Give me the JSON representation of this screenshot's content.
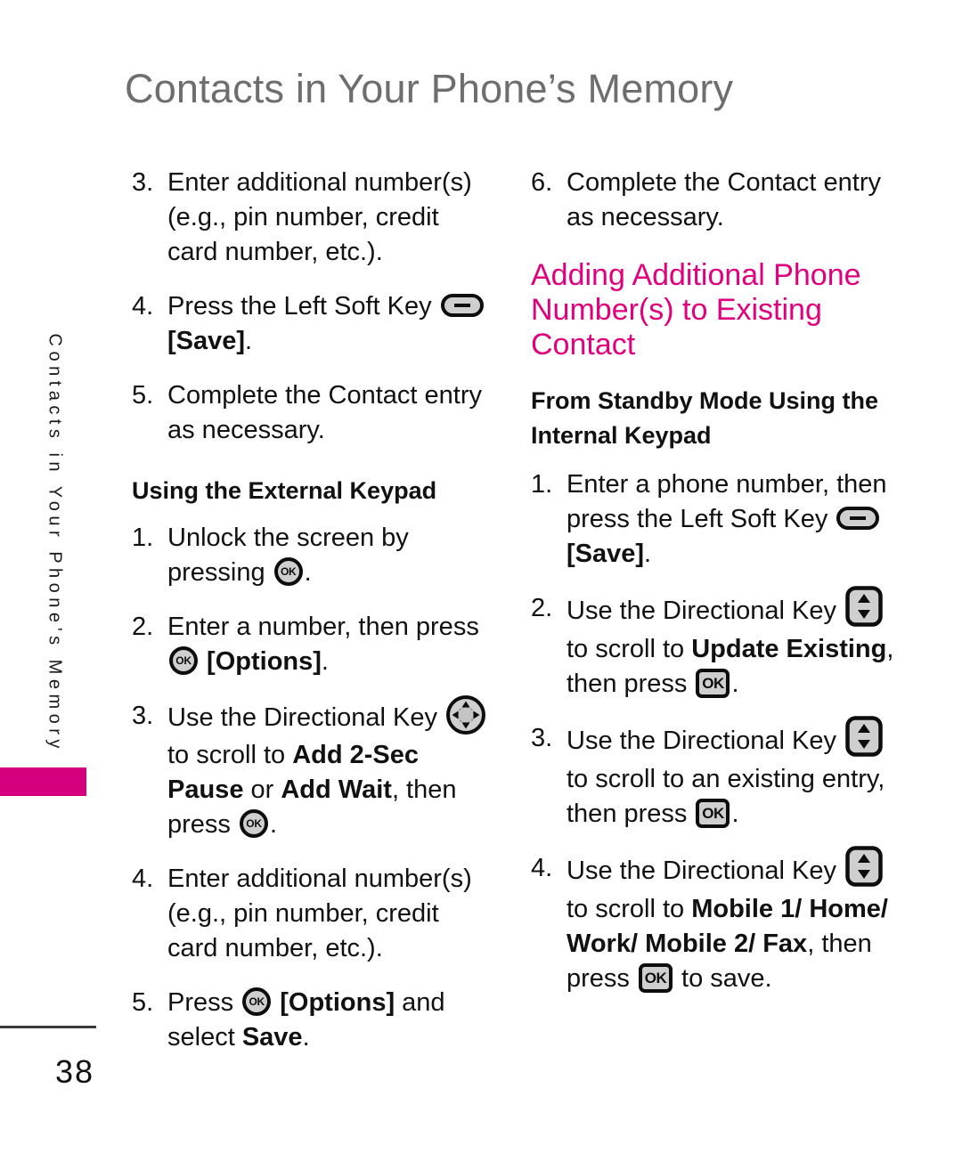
{
  "header": {
    "title": "Contacts in Your Phone’s Memory"
  },
  "side_tab": {
    "text": "Contacts in Your Phone’s Memory",
    "color": "#d6007f"
  },
  "colors": {
    "accent_pink": "#e0007d",
    "title_gray": "#6e6e6e",
    "body_black": "#111111",
    "icon_fill": "#cfcfcf",
    "icon_stroke": "#0d0d0d"
  },
  "left_column": {
    "steps_continued": [
      {
        "num": "3.",
        "parts": [
          {
            "type": "text",
            "value": "Enter additional number(s) (e.g., pin number, credit card number, etc.)."
          }
        ]
      },
      {
        "num": "4.",
        "parts": [
          {
            "type": "text",
            "value": "Press the Left Soft Key "
          },
          {
            "type": "icon",
            "icon": "left-soft-key"
          },
          {
            "type": "bold",
            "value": " [Save]"
          },
          {
            "type": "text",
            "value": "."
          }
        ]
      },
      {
        "num": "5.",
        "parts": [
          {
            "type": "text",
            "value": "Complete the Contact entry as necessary."
          }
        ]
      }
    ],
    "subheading": "Using the External Keypad",
    "steps": [
      {
        "num": "1.",
        "parts": [
          {
            "type": "text",
            "value": "Unlock the screen by pressing "
          },
          {
            "type": "icon",
            "icon": "ok-round-key"
          },
          {
            "type": "text",
            "value": "."
          }
        ]
      },
      {
        "num": "2.",
        "parts": [
          {
            "type": "text",
            "value": "Enter a number, then press "
          },
          {
            "type": "icon",
            "icon": "ok-round-key"
          },
          {
            "type": "bold",
            "value": " [Options]"
          },
          {
            "type": "text",
            "value": "."
          }
        ]
      },
      {
        "num": "3.",
        "parts": [
          {
            "type": "text",
            "value": "Use the Directional Key "
          },
          {
            "type": "icon",
            "icon": "directional-key-4way"
          },
          {
            "type": "text",
            "value": " to scroll to "
          },
          {
            "type": "bold",
            "value": "Add 2-Sec Pause"
          },
          {
            "type": "text",
            "value": " or "
          },
          {
            "type": "bold",
            "value": "Add Wait"
          },
          {
            "type": "text",
            "value": ", then press "
          },
          {
            "type": "icon",
            "icon": "ok-round-key"
          },
          {
            "type": "text",
            "value": "."
          }
        ]
      },
      {
        "num": "4.",
        "parts": [
          {
            "type": "text",
            "value": "Enter additional number(s) (e.g., pin number, credit card number, etc.)."
          }
        ]
      },
      {
        "num": "5.",
        "parts": [
          {
            "type": "text",
            "value": "Press "
          },
          {
            "type": "icon",
            "icon": "ok-round-key"
          },
          {
            "type": "bold",
            "value": " [Options]"
          },
          {
            "type": "text",
            "value": " and select "
          },
          {
            "type": "bold",
            "value": "Save"
          },
          {
            "type": "text",
            "value": "."
          }
        ]
      }
    ]
  },
  "right_column": {
    "steps_continued": [
      {
        "num": "6.",
        "parts": [
          {
            "type": "text",
            "value": "Complete the Contact entry as necessary."
          }
        ]
      }
    ],
    "section_heading": "Adding Additional Phone Number(s) to Existing Contact",
    "subheading": "From Standby Mode Using the Internal Keypad",
    "steps": [
      {
        "num": "1.",
        "parts": [
          {
            "type": "text",
            "value": "Enter a phone number, then press the Left Soft Key "
          },
          {
            "type": "icon",
            "icon": "left-soft-key"
          },
          {
            "type": "bold",
            "value": " [Save]"
          },
          {
            "type": "text",
            "value": "."
          }
        ]
      },
      {
        "num": "2.",
        "parts": [
          {
            "type": "text",
            "value": "Use the Directional Key "
          },
          {
            "type": "icon",
            "icon": "directional-key-updown"
          },
          {
            "type": "text",
            "value": " to scroll to "
          },
          {
            "type": "bold",
            "value": "Update Existing"
          },
          {
            "type": "text",
            "value": ", then press "
          },
          {
            "type": "icon",
            "icon": "ok-square-key"
          },
          {
            "type": "text",
            "value": "."
          }
        ]
      },
      {
        "num": "3.",
        "parts": [
          {
            "type": "text",
            "value": "Use the Directional Key "
          },
          {
            "type": "icon",
            "icon": "directional-key-updown"
          },
          {
            "type": "text",
            "value": " to scroll to an existing entry, then press "
          },
          {
            "type": "icon",
            "icon": "ok-square-key"
          },
          {
            "type": "text",
            "value": "."
          }
        ]
      },
      {
        "num": "4.",
        "parts": [
          {
            "type": "text",
            "value": "Use the Directional Key "
          },
          {
            "type": "icon",
            "icon": "directional-key-updown"
          },
          {
            "type": "text",
            "value": " to scroll to "
          },
          {
            "type": "bold",
            "value": "Mobile 1/ Home/ Work/ Mobile 2/ Fax"
          },
          {
            "type": "text",
            "value": ", then press "
          },
          {
            "type": "icon",
            "icon": "ok-square-key"
          },
          {
            "type": "text",
            "value": " to save."
          }
        ]
      }
    ]
  },
  "footer": {
    "page_number": "38"
  },
  "icon_labels": {
    "ok_text": "OK"
  }
}
